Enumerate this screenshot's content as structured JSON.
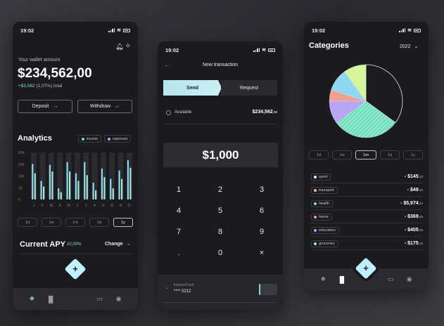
{
  "wallet": {
    "time": "19:02",
    "amount_label": "Your wallet amount",
    "amount": "$234,562,00",
    "change_value": "+$3,562",
    "change_pct": " (1,07%) total",
    "deposit_label": "Deposit",
    "withdraw_label": "Withdraw",
    "analytics_title": "Analytics",
    "legend_income": "income",
    "legend_expences": "expences",
    "y_ticks": [
      "50K",
      "20K",
      "10K",
      "1K",
      "0"
    ],
    "months": [
      "J",
      "F",
      "M",
      "A",
      "M",
      "J",
      "J",
      "A",
      "S",
      "O",
      "N",
      "D"
    ],
    "ranges": [
      "1d",
      "1w",
      "1m",
      "1q",
      "1y"
    ],
    "active_range": "1y",
    "apy_title": "Current APY",
    "apy_value": "10,00%",
    "change_link": "Change",
    "chart_data": {
      "type": "bar",
      "categories": [
        "J",
        "F",
        "M",
        "A",
        "M",
        "J",
        "J",
        "A",
        "S",
        "O",
        "N",
        "D"
      ],
      "ylim": [
        0,
        50
      ],
      "series": [
        {
          "name": "income",
          "values": [
            38,
            20,
            37,
            12,
            40,
            28,
            40,
            18,
            33,
            22,
            31,
            42
          ]
        },
        {
          "name": "expences",
          "values": [
            28,
            14,
            30,
            8,
            30,
            20,
            26,
            10,
            24,
            12,
            22,
            34
          ]
        }
      ],
      "colors": {
        "income": "#8fd9f0",
        "expences": "#a9ebd4"
      }
    }
  },
  "transaction": {
    "time": "19:02",
    "title": "New transaction",
    "tab_send": "Send",
    "tab_request": "Request",
    "available_label": "Available",
    "available_amount": "$234,562",
    "available_cents": ",98",
    "amount": "$1,000",
    "keys": [
      "1",
      "2",
      "3",
      "4",
      "5",
      "6",
      "7",
      "8",
      "9",
      ".",
      "0",
      "×"
    ],
    "card_label": "MasterCard",
    "card_number": "**** 0212"
  },
  "categories": {
    "time": "19:02",
    "title": "Categories",
    "year": "2022",
    "ranges": [
      "1d",
      "1w",
      "1m",
      "1q",
      "1y"
    ],
    "active_range": "1m",
    "items": [
      {
        "name": "sport",
        "amount": "- $145",
        "cents": ",10",
        "color": "#ffffff"
      },
      {
        "name": "transport",
        "amount": "- $49",
        "cents": ",00",
        "color": "#f2c86b"
      },
      {
        "name": "health",
        "amount": "- $5,974",
        "cents": ",24",
        "color": "#8fd9f0"
      },
      {
        "name": "home",
        "amount": "- $369",
        "cents": ",00",
        "color": "#f0a090"
      },
      {
        "name": "education",
        "amount": "- $405",
        "cents": ",00",
        "color": "#b8a6f5"
      },
      {
        "name": "groceries",
        "amount": "- $175",
        "cents": ",10",
        "color": "#a9ebd4"
      }
    ],
    "pie": [
      {
        "color": "#1c1c20",
        "value": 35
      },
      {
        "color": "#6fdcc0",
        "value": 30
      },
      {
        "color": "#b8a6f5",
        "value": 10
      },
      {
        "color": "#f0a090",
        "value": 5
      },
      {
        "color": "#8fd9f0",
        "value": 10
      },
      {
        "color": "#d6f59a",
        "value": 10
      }
    ]
  }
}
